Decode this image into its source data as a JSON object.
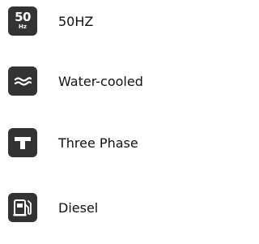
{
  "specs": [
    {
      "label": "50HZ",
      "icon": "frequency-icon",
      "icon_text": {
        "value": "50",
        "unit": "Hz"
      }
    },
    {
      "label": "Water-cooled",
      "icon": "water-waves-icon"
    },
    {
      "label": "Three Phase",
      "icon": "three-phase-icon"
    },
    {
      "label": "Diesel",
      "icon": "fuel-pump-icon"
    }
  ],
  "colors": {
    "icon_background": "#333333",
    "icon_foreground": "#ffffff",
    "text": "#111111",
    "page_background": "#ffffff"
  }
}
